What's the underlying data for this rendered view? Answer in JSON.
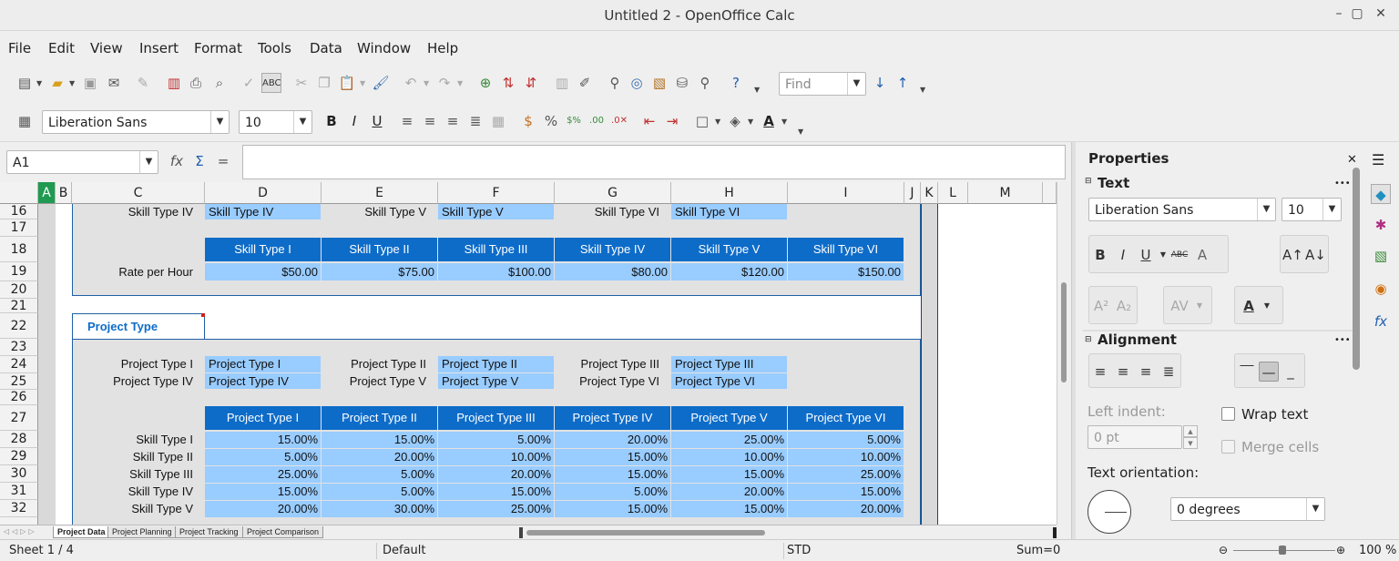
{
  "window": {
    "title": "Untitled 2 - OpenOffice Calc"
  },
  "menu": [
    "File",
    "Edit",
    "View",
    "Insert",
    "Format",
    "Tools",
    "Data",
    "Window",
    "Help"
  ],
  "toolbar": {
    "find_placeholder": "Find",
    "font_name": "Liberation Sans",
    "font_size": "10"
  },
  "formula_bar": {
    "cell_ref": "A1",
    "content": ""
  },
  "columns": [
    "A",
    "B",
    "C",
    "D",
    "E",
    "F",
    "G",
    "H",
    "I",
    "J",
    "K",
    "L",
    "M"
  ],
  "rows": [
    "16",
    "17",
    "18",
    "19",
    "20",
    "21",
    "22",
    "23",
    "24",
    "25",
    "26",
    "27",
    "28",
    "29",
    "30",
    "31",
    "32"
  ],
  "sheet": {
    "skill_inputs_row16": [
      {
        "label": "Skill Type IV",
        "value": "Skill Type IV"
      },
      {
        "label": "Skill Type V",
        "value": "Skill Type V"
      },
      {
        "label": "Skill Type VI",
        "value": "Skill Type VI"
      }
    ],
    "skill_headers": [
      "Skill Type I",
      "Skill Type II",
      "Skill Type III",
      "Skill Type IV",
      "Skill Type V",
      "Skill Type VI"
    ],
    "rate_label": "Rate per Hour",
    "rates": [
      "$50.00",
      "$75.00",
      "$100.00",
      "$80.00",
      "$120.00",
      "$150.00"
    ],
    "project_type_title": "Project Type",
    "project_inputs": [
      [
        {
          "label": "Project Type I",
          "value": "Project Type I"
        },
        {
          "label": "Project Type II",
          "value": "Project Type II"
        },
        {
          "label": "Project Type III",
          "value": "Project Type III"
        }
      ],
      [
        {
          "label": "Project Type IV",
          "value": "Project Type IV"
        },
        {
          "label": "Project Type V",
          "value": "Project Type V"
        },
        {
          "label": "Project Type VI",
          "value": "Project Type VI"
        }
      ]
    ],
    "project_headers": [
      "Project Type I",
      "Project Type II",
      "Project Type III",
      "Project Type IV",
      "Project Type V",
      "Project Type VI"
    ],
    "mix_rows": [
      {
        "label": "Skill Type I",
        "values": [
          "15.00%",
          "15.00%",
          "5.00%",
          "20.00%",
          "25.00%",
          "5.00%"
        ]
      },
      {
        "label": "Skill Type II",
        "values": [
          "5.00%",
          "20.00%",
          "10.00%",
          "15.00%",
          "10.00%",
          "10.00%"
        ]
      },
      {
        "label": "Skill Type III",
        "values": [
          "25.00%",
          "5.00%",
          "20.00%",
          "15.00%",
          "15.00%",
          "25.00%"
        ]
      },
      {
        "label": "Skill Type IV",
        "values": [
          "15.00%",
          "5.00%",
          "15.00%",
          "5.00%",
          "20.00%",
          "15.00%"
        ]
      },
      {
        "label": "Skill Type V",
        "values": [
          "20.00%",
          "30.00%",
          "25.00%",
          "15.00%",
          "15.00%",
          "20.00%"
        ]
      }
    ]
  },
  "sheet_tabs": [
    "Project Data",
    "Project Planning",
    "Project Tracking",
    "Project Comparison"
  ],
  "status": {
    "sheet": "Sheet 1 / 4",
    "style": "Default",
    "mode": "STD",
    "sum": "Sum=0",
    "zoom": "100 %"
  },
  "sidebar": {
    "title": "Properties",
    "text_section": "Text",
    "font_name": "Liberation Sans",
    "font_size": "10",
    "alignment_section": "Alignment",
    "left_indent_label": "Left indent:",
    "left_indent_value": "0 pt",
    "wrap_text": "Wrap text",
    "merge_cells": "Merge cells",
    "text_orientation_label": "Text orientation:",
    "orientation_value": "0 degrees"
  }
}
